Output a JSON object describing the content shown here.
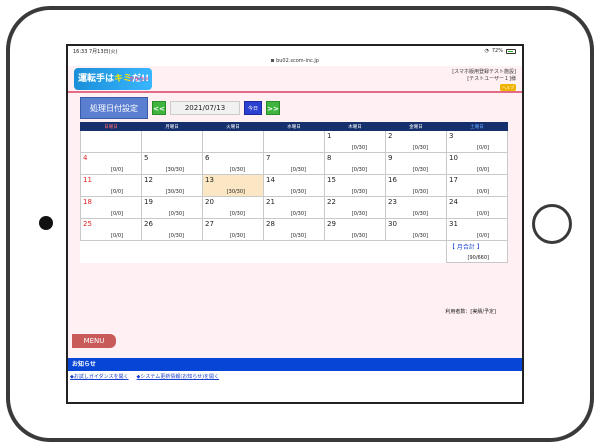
{
  "status_bar": {
    "time": "16:33  7月13日(火)",
    "battery": "72%"
  },
  "url": "bu02.scom-inc.jp",
  "logo": {
    "small": "運転手はキミだ!!",
    "main_a": "運転手は",
    "main_b": "キミ",
    "main_c": "だ!!",
    "sub": "クラウド"
  },
  "header": {
    "company": "[スマホ版用登録テスト施設]",
    "user": "[テストユーザー１]様",
    "help": "ヘルプ"
  },
  "controls": {
    "title": "処理日付設定",
    "prev": "<<",
    "date": "2021/07/13",
    "today": "今日",
    "next": ">>"
  },
  "calendar": {
    "weekdays": [
      "日曜日",
      "月曜日",
      "火曜日",
      "水曜日",
      "木曜日",
      "金曜日",
      "土曜日"
    ],
    "weeks": [
      [
        {
          "d": "",
          "v": ""
        },
        {
          "d": "",
          "v": ""
        },
        {
          "d": "",
          "v": ""
        },
        {
          "d": "",
          "v": ""
        },
        {
          "d": "1",
          "v": "[0/30]"
        },
        {
          "d": "2",
          "v": "[0/30]"
        },
        {
          "d": "3",
          "v": "[0/0]"
        }
      ],
      [
        {
          "d": "4",
          "v": "[0/0]"
        },
        {
          "d": "5",
          "v": "[30/30]"
        },
        {
          "d": "6",
          "v": "[0/30]"
        },
        {
          "d": "7",
          "v": "[0/30]"
        },
        {
          "d": "8",
          "v": "[0/30]"
        },
        {
          "d": "9",
          "v": "[0/30]"
        },
        {
          "d": "10",
          "v": "[0/0]"
        }
      ],
      [
        {
          "d": "11",
          "v": "[0/0]"
        },
        {
          "d": "12",
          "v": "[30/30]"
        },
        {
          "d": "13",
          "v": "[30/30]"
        },
        {
          "d": "14",
          "v": "[0/30]"
        },
        {
          "d": "15",
          "v": "[0/30]"
        },
        {
          "d": "16",
          "v": "[0/30]"
        },
        {
          "d": "17",
          "v": "[0/0]"
        }
      ],
      [
        {
          "d": "18",
          "v": "[0/0]"
        },
        {
          "d": "19",
          "v": "[0/30]"
        },
        {
          "d": "20",
          "v": "[0/30]"
        },
        {
          "d": "21",
          "v": "[0/30]"
        },
        {
          "d": "22",
          "v": "[0/30]"
        },
        {
          "d": "23",
          "v": "[0/30]"
        },
        {
          "d": "24",
          "v": "[0/0]"
        }
      ],
      [
        {
          "d": "25",
          "v": "[0/0]"
        },
        {
          "d": "26",
          "v": "[0/30]"
        },
        {
          "d": "27",
          "v": "[0/30]"
        },
        {
          "d": "28",
          "v": "[0/30]"
        },
        {
          "d": "29",
          "v": "[0/30]"
        },
        {
          "d": "30",
          "v": "[0/30]"
        },
        {
          "d": "31",
          "v": "[0/0]"
        }
      ]
    ],
    "summary": {
      "label": "【 月合計 】",
      "value": "[90/660]"
    },
    "legend": "利用者数：[実績/予定]"
  },
  "menu": "MENU",
  "news": {
    "title": "お知らせ",
    "links": [
      "◆お試しガイダンスを開く",
      "◆システム更新情報(お知らせ)を開く"
    ]
  },
  "colors": {
    "header_bg": "#16306e",
    "today_bg": "#fce7c4",
    "nav_green": "#3fb53f",
    "news_blue": "#0645d6",
    "page_pink": "#fff0f3"
  }
}
